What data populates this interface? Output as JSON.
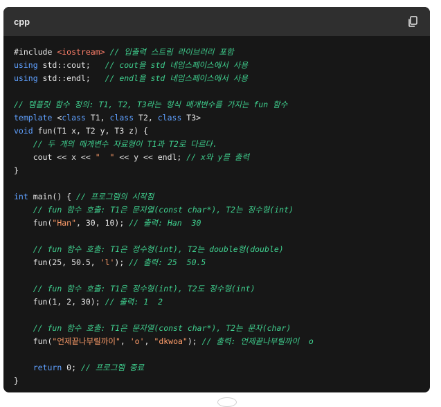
{
  "header": {
    "language": "cpp",
    "copy_icon": "copy-icon"
  },
  "colors": {
    "background": "#171717",
    "header": "#2f2f2f",
    "keyword": "#5fa0ff",
    "string": "#ff9d6a",
    "comment": "#3fcf8e",
    "text": "#e6e6e6"
  },
  "code": [
    [
      {
        "t": "#include ",
        "c": "plain"
      },
      {
        "t": "<iostream>",
        "c": "inc"
      },
      {
        "t": " // 입출력 스트림 라이브러리 포함",
        "c": "cm"
      }
    ],
    [
      {
        "t": "using",
        "c": "kw"
      },
      {
        "t": " std::cout;   ",
        "c": "plain"
      },
      {
        "t": "// cout을 std 네임스페이스에서 사용",
        "c": "cm"
      }
    ],
    [
      {
        "t": "using",
        "c": "kw"
      },
      {
        "t": " std::endl;   ",
        "c": "plain"
      },
      {
        "t": "// endl을 std 네임스페이스에서 사용",
        "c": "cm"
      }
    ],
    [],
    [
      {
        "t": "// 템플릿 함수 정의: T1, T2, T3라는 형식 매개변수를 가지는 fun 함수",
        "c": "cm"
      }
    ],
    [
      {
        "t": "template",
        "c": "kw"
      },
      {
        "t": " <",
        "c": "plain"
      },
      {
        "t": "class",
        "c": "kw"
      },
      {
        "t": " T1, ",
        "c": "plain"
      },
      {
        "t": "class",
        "c": "kw"
      },
      {
        "t": " T2, ",
        "c": "plain"
      },
      {
        "t": "class",
        "c": "kw"
      },
      {
        "t": " T3>",
        "c": "plain"
      }
    ],
    [
      {
        "t": "void",
        "c": "kw"
      },
      {
        "t": " fun(T1 x, T2 y, T3 z) {",
        "c": "plain"
      }
    ],
    [
      {
        "t": "    ",
        "c": "plain"
      },
      {
        "t": "// 두 개의 매개변수 자료형이 T1과 T2로 다르다.",
        "c": "cm"
      }
    ],
    [
      {
        "t": "    cout << x << ",
        "c": "plain"
      },
      {
        "t": "\"  \"",
        "c": "str"
      },
      {
        "t": " << y << endl; ",
        "c": "plain"
      },
      {
        "t": "// x와 y를 출력",
        "c": "cm"
      }
    ],
    [
      {
        "t": "}",
        "c": "plain"
      }
    ],
    [],
    [
      {
        "t": "int",
        "c": "kw"
      },
      {
        "t": " main() { ",
        "c": "plain"
      },
      {
        "t": "// 프로그램의 시작점",
        "c": "cm"
      }
    ],
    [
      {
        "t": "    ",
        "c": "plain"
      },
      {
        "t": "// fun 함수 호출: T1은 문자열(const char*), T2는 정수형(int)",
        "c": "cm"
      }
    ],
    [
      {
        "t": "    fun(",
        "c": "plain"
      },
      {
        "t": "\"Han\"",
        "c": "str"
      },
      {
        "t": ", 30, 10); ",
        "c": "plain"
      },
      {
        "t": "// 출력: Han  30",
        "c": "cm"
      }
    ],
    [],
    [
      {
        "t": "    ",
        "c": "plain"
      },
      {
        "t": "// fun 함수 호출: T1은 정수형(int), T2는 double형(double)",
        "c": "cm"
      }
    ],
    [
      {
        "t": "    fun(25, 50.5, ",
        "c": "plain"
      },
      {
        "t": "'l'",
        "c": "str"
      },
      {
        "t": "); ",
        "c": "plain"
      },
      {
        "t": "// 출력: 25  50.5",
        "c": "cm"
      }
    ],
    [],
    [
      {
        "t": "    ",
        "c": "plain"
      },
      {
        "t": "// fun 함수 호출: T1은 정수형(int), T2도 정수형(int)",
        "c": "cm"
      }
    ],
    [
      {
        "t": "    fun(1, 2, 30); ",
        "c": "plain"
      },
      {
        "t": "// 출력: 1  2",
        "c": "cm"
      }
    ],
    [],
    [
      {
        "t": "    ",
        "c": "plain"
      },
      {
        "t": "// fun 함수 호출: T1은 문자열(const char*), T2는 문자(char)",
        "c": "cm"
      }
    ],
    [
      {
        "t": "    fun(",
        "c": "plain"
      },
      {
        "t": "\"언제끝나부릴까이\"",
        "c": "str"
      },
      {
        "t": ", ",
        "c": "plain"
      },
      {
        "t": "'o'",
        "c": "str"
      },
      {
        "t": ", ",
        "c": "plain"
      },
      {
        "t": "\"dkwoa\"",
        "c": "str"
      },
      {
        "t": "); ",
        "c": "plain"
      },
      {
        "t": "// 출력: 언제끝나부릴까이  o",
        "c": "cm"
      }
    ],
    [],
    [
      {
        "t": "    ",
        "c": "plain"
      },
      {
        "t": "return",
        "c": "kw"
      },
      {
        "t": " 0; ",
        "c": "plain"
      },
      {
        "t": "// 프로그램 종료",
        "c": "cm"
      }
    ],
    [
      {
        "t": "}",
        "c": "plain"
      }
    ]
  ]
}
